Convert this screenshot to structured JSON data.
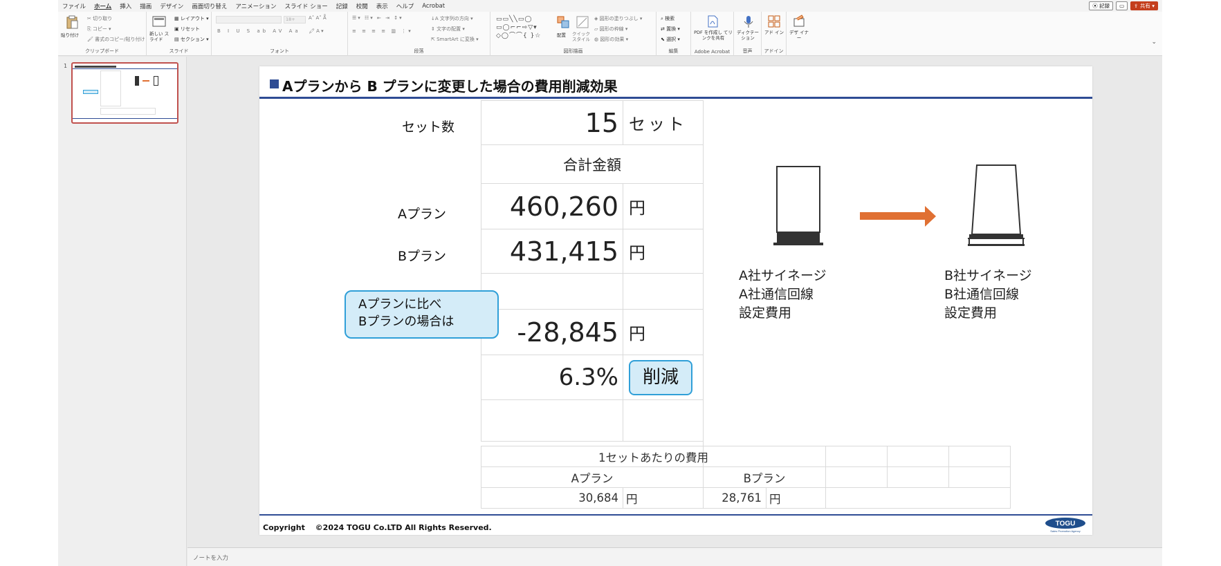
{
  "menu": {
    "items": [
      "ファイル",
      "ホーム",
      "挿入",
      "描画",
      "デザイン",
      "画面切り替え",
      "アニメーション",
      "スライド ショー",
      "記録",
      "校閲",
      "表示",
      "ヘルプ",
      "Acrobat"
    ],
    "active_index": 1,
    "record_label": "記録",
    "share_label": "共有"
  },
  "ribbon": {
    "clipboard": {
      "paste": "貼り付け",
      "cut": "切り取り",
      "copy": "コピー",
      "format_painter": "書式のコピー/貼り付け",
      "label": "クリップボード"
    },
    "slides": {
      "new_slide": "新しい スライド",
      "layout": "レイアウト",
      "reset": "リセット",
      "section": "セクション",
      "label": "スライド"
    },
    "font": {
      "size": "18+",
      "label": "フォント"
    },
    "paragraph": {
      "text_direction": "文字列の方向",
      "align_text": "文字の配置",
      "smartart": "SmartArt に変換",
      "label": "段落"
    },
    "drawing": {
      "arrange": "配置",
      "quick_styles": "クイック スタイル",
      "fill": "図形の塗りつぶし",
      "outline": "図形の枠線",
      "effects": "図形の効果",
      "label": "図形描画"
    },
    "editing": {
      "find": "検索",
      "replace": "置換",
      "select": "選択",
      "label": "編集"
    },
    "acrobat": {
      "pdf": "PDF を作成し てリンクを共有",
      "label": "Adobe Acrobat"
    },
    "voice": {
      "dictate": "ディクテー ション",
      "label": "音声"
    },
    "addins": {
      "addins": "アド イン",
      "label": "アドイン"
    },
    "designer": {
      "designer": "デザ イナー"
    }
  },
  "thumbnail": {
    "slide_number": "1"
  },
  "notes": {
    "placeholder": "ノートを入力"
  },
  "slide": {
    "title": "Aプランから B プランに変更した場合の費用削減効果",
    "labels": {
      "sets": "セット数",
      "plan_a": "Aプラン",
      "plan_b": "Bプラン"
    },
    "table": {
      "sets_value": "15",
      "sets_unit": "セット",
      "total_header": "合計金額",
      "plan_a_value": "460,260",
      "plan_b_value": "431,415",
      "yen": "円",
      "diff_value": "-28,845",
      "percent_value": "6.3%",
      "reduce_badge": "削減"
    },
    "callout": {
      "line1": "Aプランに比べ",
      "line2": "Bプランの場合は"
    },
    "sign_a": {
      "text": "A社サイネージ\nA社通信回線\n設定費用"
    },
    "sign_b": {
      "text": "B社サイネージ\nB社通信回線\n設定費用"
    },
    "arrow_color": "#e07033",
    "per_set": {
      "header": "1セットあたりの費用",
      "col_a": "Aプラン",
      "col_b": "Bプラン",
      "value_a": "30,684",
      "value_b": "28,761",
      "unit": "円"
    },
    "footer": {
      "copyright": "Copyright　 ©2024 TOGU Co.LTD  All Rights Reserved.",
      "logo_text": "TOGU",
      "logo_sub": "Sales Promotion Agency"
    },
    "accent_color": "#2e4c94",
    "callout_color": "#d4ecf8"
  }
}
